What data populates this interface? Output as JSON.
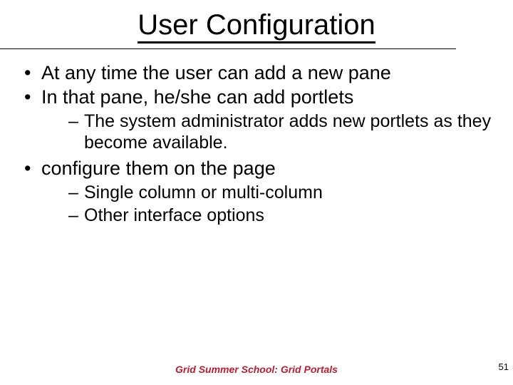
{
  "title": "User Configuration",
  "bullets": [
    {
      "text": "At any time the user can add a new pane"
    },
    {
      "text": "In that pane, he/she can add portlets",
      "sub": [
        "The system administrator adds new portlets as they become available."
      ]
    },
    {
      "text": "configure them on the page",
      "sub": [
        "Single column or multi-column",
        "Other interface options"
      ]
    }
  ],
  "footer": "Grid Summer School: Grid Portals",
  "page_number": "51"
}
